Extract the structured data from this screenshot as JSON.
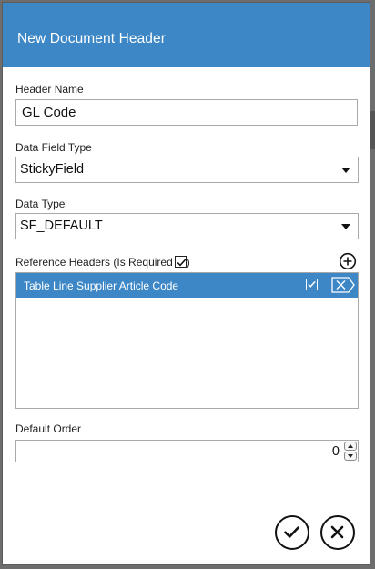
{
  "dialog": {
    "title": "New Document Header"
  },
  "fields": {
    "header_name": {
      "label": "Header Name",
      "value": "GL Code"
    },
    "data_field_type": {
      "label": "Data Field Type",
      "selected": "StickyField"
    },
    "data_type": {
      "label": "Data Type",
      "selected": "SF_DEFAULT"
    },
    "reference_headers": {
      "label_prefix": "Reference Headers (Is Required",
      "label_suffix": ")",
      "is_required_checked": true,
      "items": [
        {
          "label": "Table Line Supplier Article Code",
          "required": true
        }
      ]
    },
    "default_order": {
      "label": "Default Order",
      "value": "0"
    }
  },
  "icons": {
    "add": "plus-circle-icon",
    "row_delete": "delete-tag-icon",
    "confirm": "checkmark-icon",
    "cancel": "close-icon"
  },
  "colors": {
    "accent": "#3d87c7",
    "overlay": "#6d6d6d"
  }
}
